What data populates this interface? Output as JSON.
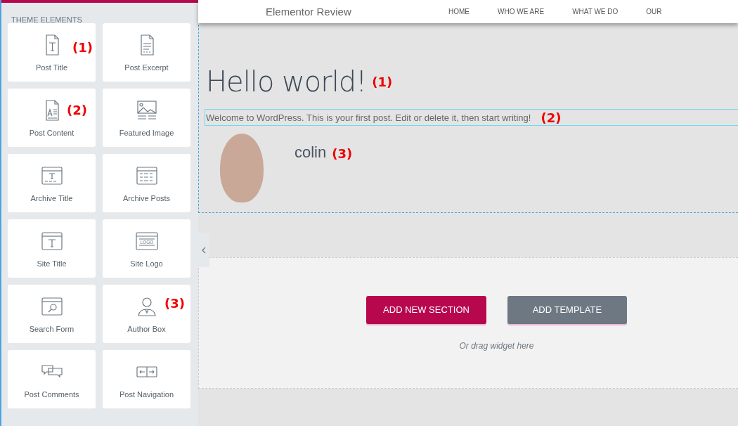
{
  "sidebar": {
    "section_title": "THEME ELEMENTS",
    "widgets": [
      {
        "label": "Post Title",
        "note": "(1)"
      },
      {
        "label": "Post Excerpt"
      },
      {
        "label": "Post Content",
        "note": "(2)"
      },
      {
        "label": "Featured Image"
      },
      {
        "label": "Archive Title"
      },
      {
        "label": "Archive Posts"
      },
      {
        "label": "Site Title"
      },
      {
        "label": "Site Logo",
        "logo_text": "LOGO"
      },
      {
        "label": "Search Form"
      },
      {
        "label": "Author Box",
        "note": "(3)"
      },
      {
        "label": "Post Comments"
      },
      {
        "label": "Post Navigation"
      }
    ]
  },
  "site_header": {
    "site_name": "Elementor Review",
    "nav": [
      "HOME",
      "WHO WE ARE",
      "WHAT WE DO",
      "OUR"
    ]
  },
  "post": {
    "title": "Hello world!",
    "title_note": "(1)",
    "content": "Welcome to WordPress. This is your first post. Edit or delete it, then start writing!",
    "content_note": "(2)",
    "author": "colin",
    "author_note": "(3)"
  },
  "drop_area": {
    "buttons": [
      {
        "label": "ADD NEW SECTION",
        "kind": "primary"
      },
      {
        "label": "ADD TEMPLATE",
        "kind": "secondary"
      }
    ],
    "hint": "Or drag widget here"
  }
}
